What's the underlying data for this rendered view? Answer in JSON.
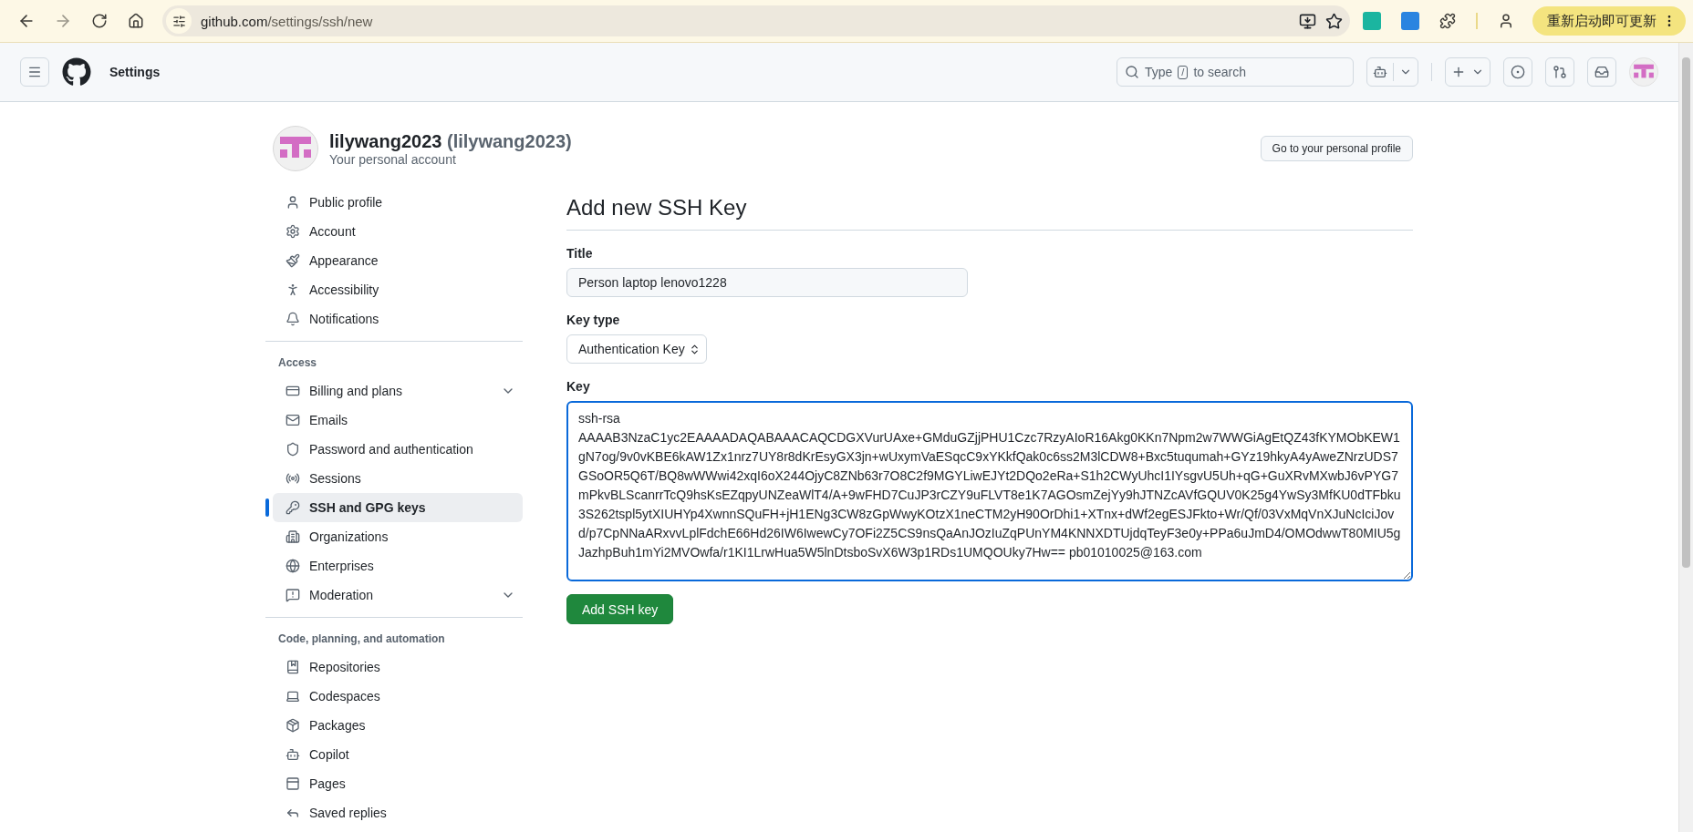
{
  "browser": {
    "url_host": "github.com",
    "url_path": "/settings/ssh/new",
    "forward_disabled": true,
    "update_button": "重新启动即可更新"
  },
  "header": {
    "title": "Settings",
    "search": {
      "placeholder_before": "Type",
      "shortcut": "/",
      "placeholder_after": "to search"
    }
  },
  "profile": {
    "name": "lilywang2023",
    "handle": "(lilywang2023)",
    "subtitle": "Your personal account",
    "button": "Go to your personal profile"
  },
  "sidebar": {
    "sections": [
      {
        "items": [
          {
            "label": "Public profile",
            "selected": false,
            "expandable": false
          },
          {
            "label": "Account",
            "selected": false,
            "expandable": false
          },
          {
            "label": "Appearance",
            "selected": false,
            "expandable": false
          },
          {
            "label": "Accessibility",
            "selected": false,
            "expandable": false
          },
          {
            "label": "Notifications",
            "selected": false,
            "expandable": false
          }
        ]
      },
      {
        "heading": "Access",
        "items": [
          {
            "label": "Billing and plans",
            "selected": false,
            "expandable": true
          },
          {
            "label": "Emails",
            "selected": false,
            "expandable": false
          },
          {
            "label": "Password and authentication",
            "selected": false,
            "expandable": false
          },
          {
            "label": "Sessions",
            "selected": false,
            "expandable": false
          },
          {
            "label": "SSH and GPG keys",
            "selected": true,
            "expandable": false
          },
          {
            "label": "Organizations",
            "selected": false,
            "expandable": false
          },
          {
            "label": "Enterprises",
            "selected": false,
            "expandable": false
          },
          {
            "label": "Moderation",
            "selected": false,
            "expandable": true
          }
        ]
      },
      {
        "heading": "Code, planning, and automation",
        "items": [
          {
            "label": "Repositories",
            "selected": false,
            "expandable": false
          },
          {
            "label": "Codespaces",
            "selected": false,
            "expandable": false
          },
          {
            "label": "Packages",
            "selected": false,
            "expandable": false
          },
          {
            "label": "Copilot",
            "selected": false,
            "expandable": false
          },
          {
            "label": "Pages",
            "selected": false,
            "expandable": false
          },
          {
            "label": "Saved replies",
            "selected": false,
            "expandable": false
          }
        ]
      }
    ]
  },
  "form": {
    "heading": "Add new SSH Key",
    "title_label": "Title",
    "title_value": "Person laptop lenovo1228",
    "key_type_label": "Key type",
    "key_type_value": "Authentication Key",
    "key_label": "Key",
    "key_lines": [
      "ssh-rsa",
      "AAAAB3NzaC1yc2EAAAADAQABAAACAQCDGXVurUAxe+GMduGZjjPHU1Czc7RzyAIoR16Akg0KKn7Npm2w7WWGiAgEtQZ43fKYMObKEW1",
      "gN7og/9v0vKBE6kAW1Zx1nrz7UY8r8dKrEsyGX3jn+wUxymVaESqcC9xYKkfQak0c6ss2M3lCDW8+Bxc5tuqumah+GYz19hkyA4yAweZNrzUDS7",
      "GSoOR5Q6T/BQ8wWWwi42xqI6oX244OjyC8ZNb63r7O8C2f9MGYLiwEJYt2DQo2eRa+S1h2CWyUhcI1IYsgvU5Uh+qG+GuXRvMXwbJ6vPYG7",
      "mPkvBLScanrrTcQ9hsKsEZqpyUNZeaWlT4/A+9wFHD7CuJP3rCZY9uFLVT8e1K7AGOsmZejYy9hJTNZcAVfGQUV0K25g4YwSy3MfKU0dTFbku",
      "3S262tspl5ytXIUHYp4XwnnSQuFH+jH1ENg3CW8zGpWwyKOtzX1neCTM2yH90OrDhi1+XTnx+dWf2egESJFkto+Wr/Qf/03VxMqVnXJuNcIciJov",
      "d/p7CpNNaARxvvLplFdchE66Hd26IW6IwewCy7OFi2Z5CS9nsQaAnJOzIuZqPUnYM4KNNXDTUjdqTeyF3e0y+PPa6uJmD4/OMOdwwT80MIU5g",
      "JazhpBuh1mYi2MVOwfa/r1KI1LrwHua5W5lnDtsboSvX6W3p1RDs1UMQOUky7Hw== pb01010025@163.com"
    ],
    "submit": "Add SSH key"
  }
}
